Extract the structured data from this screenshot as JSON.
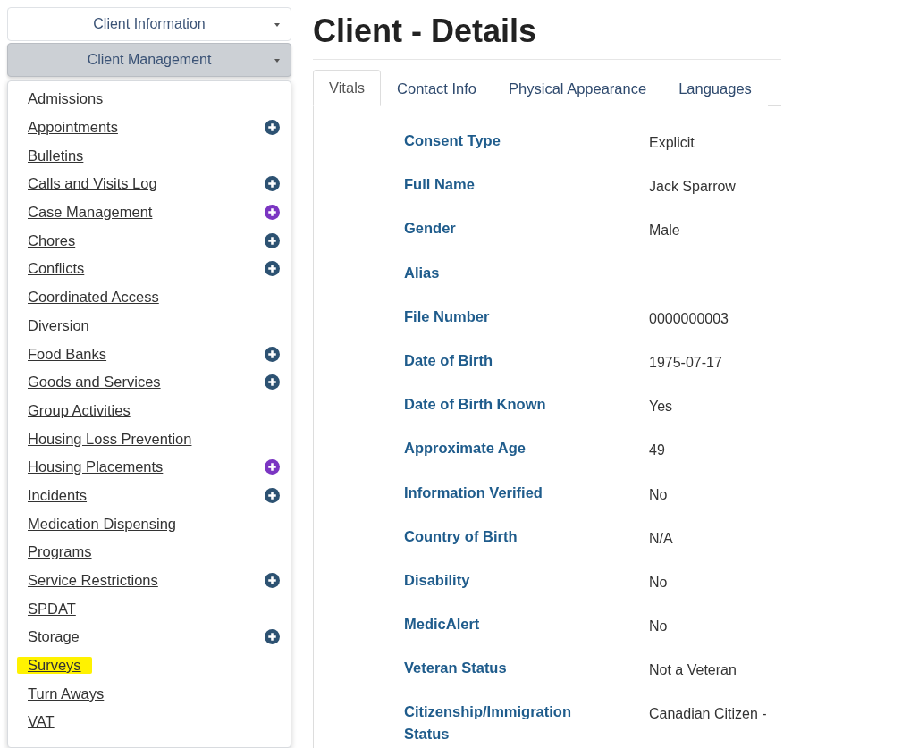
{
  "sidebar": {
    "sections": [
      {
        "label": "Client Information",
        "selected": false
      },
      {
        "label": "Client Management",
        "selected": true
      }
    ],
    "menu": [
      {
        "label": "Admissions",
        "highlighted": false
      },
      {
        "label": "Appointments",
        "highlighted": false,
        "color": "#2d5272"
      },
      {
        "label": "Bulletins",
        "highlighted": false
      },
      {
        "label": "Calls and Visits Log",
        "highlighted": false,
        "color": "#2d5272"
      },
      {
        "label": "Case Management",
        "highlighted": false,
        "color": "#7b35c2"
      },
      {
        "label": "Chores",
        "highlighted": false,
        "color": "#2d5272"
      },
      {
        "label": "Conflicts",
        "highlighted": false,
        "color": "#2d5272"
      },
      {
        "label": "Coordinated Access",
        "highlighted": false
      },
      {
        "label": "Diversion",
        "highlighted": false
      },
      {
        "label": "Food Banks",
        "highlighted": false,
        "color": "#2d5272"
      },
      {
        "label": "Goods and Services",
        "highlighted": false,
        "color": "#2d5272"
      },
      {
        "label": "Group Activities",
        "highlighted": false
      },
      {
        "label": "Housing Loss Prevention",
        "highlighted": false
      },
      {
        "label": "Housing Placements",
        "highlighted": false,
        "color": "#7b35c2"
      },
      {
        "label": "Incidents",
        "highlighted": false,
        "color": "#2d5272"
      },
      {
        "label": "Medication Dispensing",
        "highlighted": false
      },
      {
        "label": "Programs",
        "highlighted": false
      },
      {
        "label": "Service Restrictions",
        "highlighted": false,
        "color": "#2d5272"
      },
      {
        "label": "SPDAT",
        "highlighted": false
      },
      {
        "label": "Storage",
        "highlighted": false,
        "color": "#2d5272"
      },
      {
        "label": "Surveys",
        "highlighted": true
      },
      {
        "label": "Turn Aways",
        "highlighted": false
      },
      {
        "label": "VAT",
        "highlighted": false
      }
    ]
  },
  "page": {
    "title": "Client - Details",
    "tabs": [
      {
        "label": "Vitals",
        "selected": true
      },
      {
        "label": "Contact Info",
        "selected": false
      },
      {
        "label": "Physical Appearance",
        "selected": false
      },
      {
        "label": "Languages",
        "selected": false
      }
    ],
    "fields": [
      {
        "label": "Consent Type",
        "value": "Explicit"
      },
      {
        "label": "Full Name",
        "value": "Jack Sparrow"
      },
      {
        "label": "Gender",
        "value": "Male"
      },
      {
        "label": "Alias"
      },
      {
        "label": "File Number",
        "value": "0000000003"
      },
      {
        "label": "Date of Birth",
        "value": "1975-07-17"
      },
      {
        "label": "Date of Birth Known",
        "value": "Yes"
      },
      {
        "label": "Approximate Age",
        "value": "49"
      },
      {
        "label": "Information Verified",
        "value": "No"
      },
      {
        "label": "Country of Birth",
        "value": "N/A"
      },
      {
        "label": "Disability",
        "value": "No"
      },
      {
        "label": "MedicAlert",
        "value": "No"
      },
      {
        "label": "Veteran Status",
        "value": "Not a Veteran"
      },
      {
        "label": "Citizenship/Immigration Status",
        "value": "Canadian Citizen -"
      }
    ]
  }
}
